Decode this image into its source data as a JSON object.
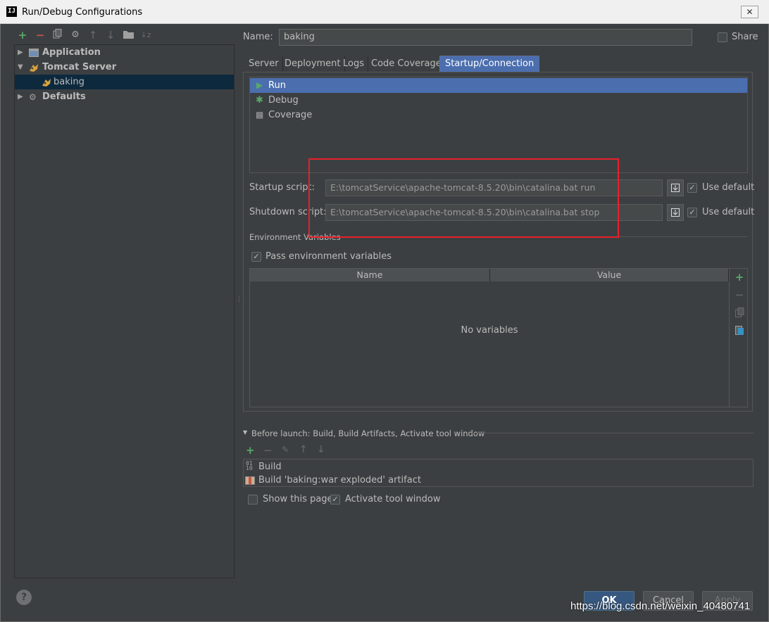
{
  "window": {
    "title": "Run/Debug Configurations",
    "icon_text": "IJ",
    "close_glyph": "✕"
  },
  "tree": {
    "items": [
      {
        "label": "Application",
        "expanded": false
      },
      {
        "label": "Tomcat Server",
        "expanded": true
      },
      {
        "label": "baking",
        "selected": true
      },
      {
        "label": "Defaults",
        "expanded": false
      }
    ]
  },
  "form": {
    "name_label": "Name:",
    "name_value": "baking",
    "share_label": "Share"
  },
  "tabs": [
    "Server",
    "Deployment",
    "Logs",
    "Code Coverage",
    "Startup/Connection"
  ],
  "active_tab": "Startup/Connection",
  "modes": [
    "Run",
    "Debug",
    "Coverage"
  ],
  "startup": {
    "label": "Startup script:",
    "value": "E:\\tomcatService\\apache-tomcat-8.5.20\\bin\\catalina.bat run",
    "use_default_label": "Use default"
  },
  "shutdown": {
    "label": "Shutdown script:",
    "value": "E:\\tomcatService\\apache-tomcat-8.5.20\\bin\\catalina.bat stop",
    "use_default_label": "Use default"
  },
  "env": {
    "section_label": "Environment Variables",
    "pass_label": "Pass environment variables",
    "columns": [
      "Name",
      "Value"
    ],
    "empty_text": "No variables"
  },
  "before_launch": {
    "header": "Before launch: Build, Build Artifacts, Activate tool window",
    "items": [
      "Build",
      "Build 'baking:war exploded' artifact"
    ],
    "show_page_label": "Show this page",
    "activate_label": "Activate tool window"
  },
  "buttons": {
    "ok": "OK",
    "cancel": "Cancel",
    "apply": "Apply",
    "help": "?"
  },
  "watermark": "https://blog.csdn.net/weixin_40480741",
  "colors": {
    "selection": "#4b6eaf",
    "add_green": "#59a869",
    "remove_red": "#c75450",
    "highlight_box": "#e8202a"
  }
}
